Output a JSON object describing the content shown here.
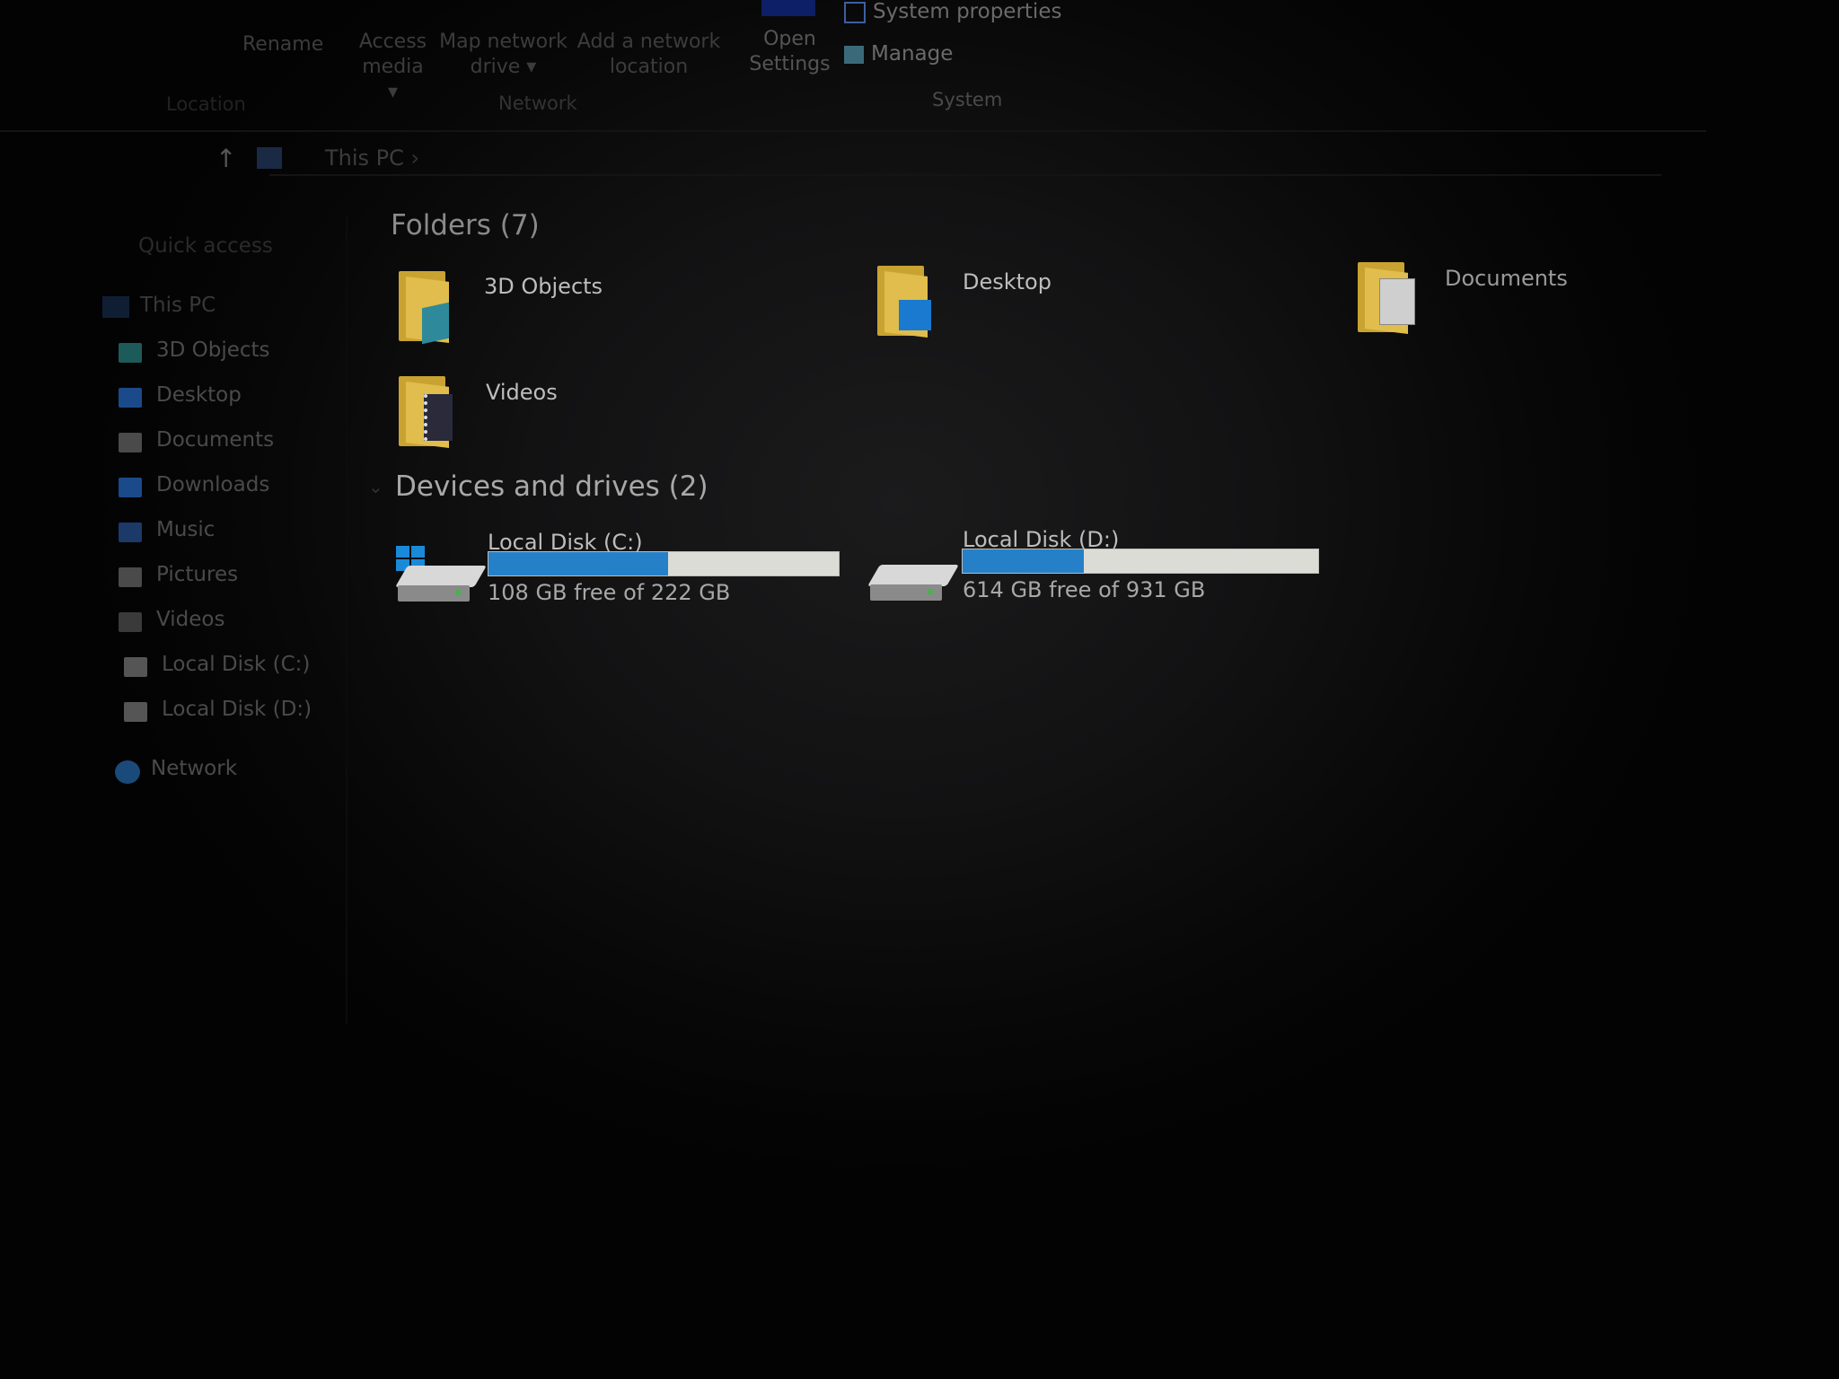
{
  "ribbon": {
    "buttons": [
      {
        "label": "Rename",
        "icon": "rename-icon"
      },
      {
        "label": "Access media ▾",
        "icon": "media-icon"
      },
      {
        "label": "Map network drive ▾",
        "icon": "map-drive-icon"
      },
      {
        "label": "Add a network location",
        "icon": "network-location-icon"
      },
      {
        "label": "Open Settings",
        "icon": "settings-icon"
      }
    ],
    "system_items": [
      {
        "label": "System properties",
        "icon": "checkbox-icon"
      },
      {
        "label": "Manage",
        "icon": "manage-icon"
      }
    ],
    "groups": {
      "location": "Location",
      "network": "Network",
      "system": "System"
    }
  },
  "address": {
    "crumb": "This PC",
    "separator": "›"
  },
  "sidebar": {
    "quick_access": "Quick access",
    "this_pc": "This PC",
    "items": [
      {
        "label": "3D Objects",
        "color": "#1d5a5a"
      },
      {
        "label": "Desktop",
        "color": "#1b4a8a"
      },
      {
        "label": "Documents",
        "color": "#4a4a4a"
      },
      {
        "label": "Downloads",
        "color": "#1b4a8a"
      },
      {
        "label": "Music",
        "color": "#1b3a6a"
      },
      {
        "label": "Pictures",
        "color": "#4a4a4a"
      },
      {
        "label": "Videos",
        "color": "#3a3a3a"
      },
      {
        "label": "Local Disk (C:)",
        "color": "#555555"
      },
      {
        "label": "Local Disk (D:)",
        "color": "#555555"
      }
    ],
    "network": "Network"
  },
  "main": {
    "folders_header": "Folders (7)",
    "folders": [
      {
        "label": "3D Objects",
        "icon": "3d-objects-folder-icon"
      },
      {
        "label": "Desktop",
        "icon": "desktop-folder-icon"
      },
      {
        "label": "Documents",
        "icon": "documents-folder-icon"
      },
      {
        "label": "Videos",
        "icon": "videos-folder-icon"
      }
    ],
    "drives_header": "Devices and drives (2)",
    "drives": [
      {
        "label": "Local Disk (C:)",
        "free_text": "108 GB free of 222 GB",
        "used_percent": 51.4
      },
      {
        "label": "Local Disk (D:)",
        "free_text": "614 GB free of 931 GB",
        "used_percent": 34.0
      }
    ]
  },
  "colors": {
    "accent": "#2680c8",
    "folder": "#e0bd4c"
  }
}
